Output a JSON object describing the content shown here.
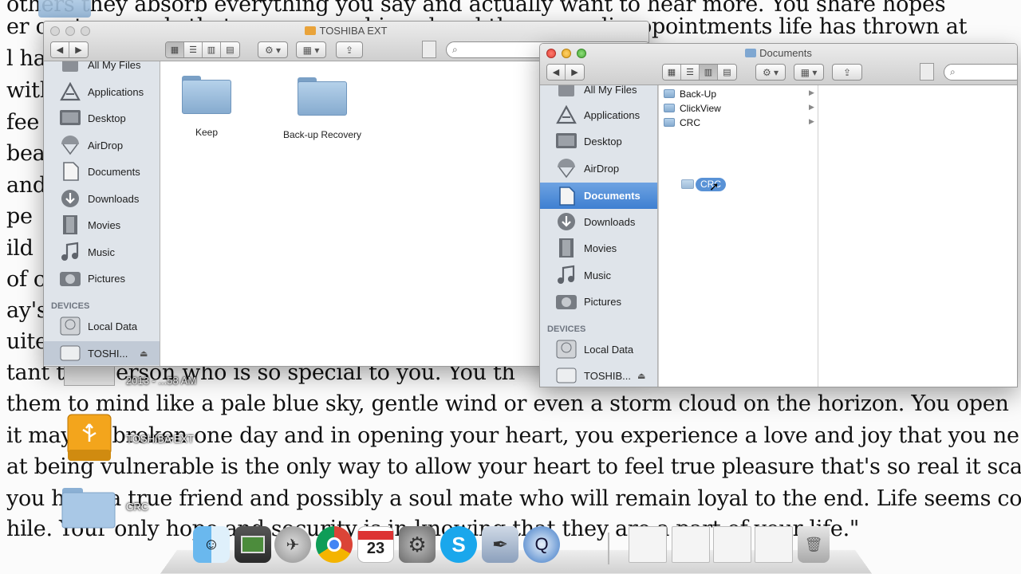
{
  "background_text": [
    "others they absorb everything you say and actually want to hear more. You share hopes",
    "er c    u true goals that you once achieved and the many disappointments life has thrown at",
    "l ha",
    "with",
    "fee",
    "bea",
    "and",
    "pe",
    "ild",
    "of c",
    "ay's",
    "uite",
    "tant this person who is so special to you. You th",
    "them to mind like a pale blue sky, gentle wind or even a storm cloud on the horizon. You open",
    "it may be broken one day and in opening your heart, you experience a love and joy that you ne",
    "at being vulnerable is the only way to allow your heart to feel true pleasure that's so real it scar",
    "you have a true friend and possibly a soul mate who will remain loyal to the end. Life seems co",
    "hile. Your only hope and security is in knowing that they are a part of your life.\""
  ],
  "desktop_icons": {
    "screenshot_label": "2013 - ...58 AM",
    "drive_label": "TOSHIBA EXT",
    "folder_label": "CRC"
  },
  "window_left": {
    "title": "TOSHIBA EXT",
    "sidebar_items": [
      {
        "label": "All My Files",
        "icon": "all-files-icon"
      },
      {
        "label": "Applications",
        "icon": "applications-icon"
      },
      {
        "label": "Desktop",
        "icon": "desktop-icon"
      },
      {
        "label": "AirDrop",
        "icon": "airdrop-icon"
      },
      {
        "label": "Documents",
        "icon": "documents-icon"
      },
      {
        "label": "Downloads",
        "icon": "downloads-icon"
      },
      {
        "label": "Movies",
        "icon": "movies-icon"
      },
      {
        "label": "Music",
        "icon": "music-icon"
      },
      {
        "label": "Pictures",
        "icon": "pictures-icon"
      }
    ],
    "devices_heading": "DEVICES",
    "devices": [
      {
        "label": "Local Data",
        "icon": "hard-disk-icon"
      },
      {
        "label": "TOSHI...",
        "icon": "external-drive-icon"
      }
    ],
    "files": [
      {
        "name": "Keep"
      },
      {
        "name": "Back-up Recovery"
      }
    ]
  },
  "window_right": {
    "title": "Documents",
    "sidebar_items": [
      {
        "label": "All My Files",
        "icon": "all-files-icon"
      },
      {
        "label": "Applications",
        "icon": "applications-icon"
      },
      {
        "label": "Desktop",
        "icon": "desktop-icon"
      },
      {
        "label": "AirDrop",
        "icon": "airdrop-icon"
      },
      {
        "label": "Documents",
        "icon": "documents-icon",
        "selected": true
      },
      {
        "label": "Downloads",
        "icon": "downloads-icon"
      },
      {
        "label": "Movies",
        "icon": "movies-icon"
      },
      {
        "label": "Music",
        "icon": "music-icon"
      },
      {
        "label": "Pictures",
        "icon": "pictures-icon"
      }
    ],
    "devices_heading": "DEVICES",
    "devices": [
      {
        "label": "Local Data",
        "icon": "hard-disk-icon"
      },
      {
        "label": "TOSHIB...",
        "icon": "external-drive-icon"
      }
    ],
    "column_items": [
      {
        "name": "Back-Up"
      },
      {
        "name": "ClickView"
      },
      {
        "name": "CRC"
      }
    ],
    "drag_label": "CRC"
  },
  "dock": [
    "finder-icon",
    "photo-booth-icon",
    "launchpad-icon",
    "chrome-icon",
    "calendar-icon",
    "system-preferences-icon",
    "skype-icon",
    "pages-icon",
    "quicktime-icon",
    "doc-thumbnail-icon",
    "doc-thumbnail-icon",
    "doc-thumbnail-icon",
    "doc-thumbnail-icon",
    "trash-icon"
  ],
  "dock_calendar_day": "23",
  "colors": {
    "selection": "#3e7fd1",
    "sidebar_bg": "#dfe4ea",
    "folder": "#86abcf"
  }
}
